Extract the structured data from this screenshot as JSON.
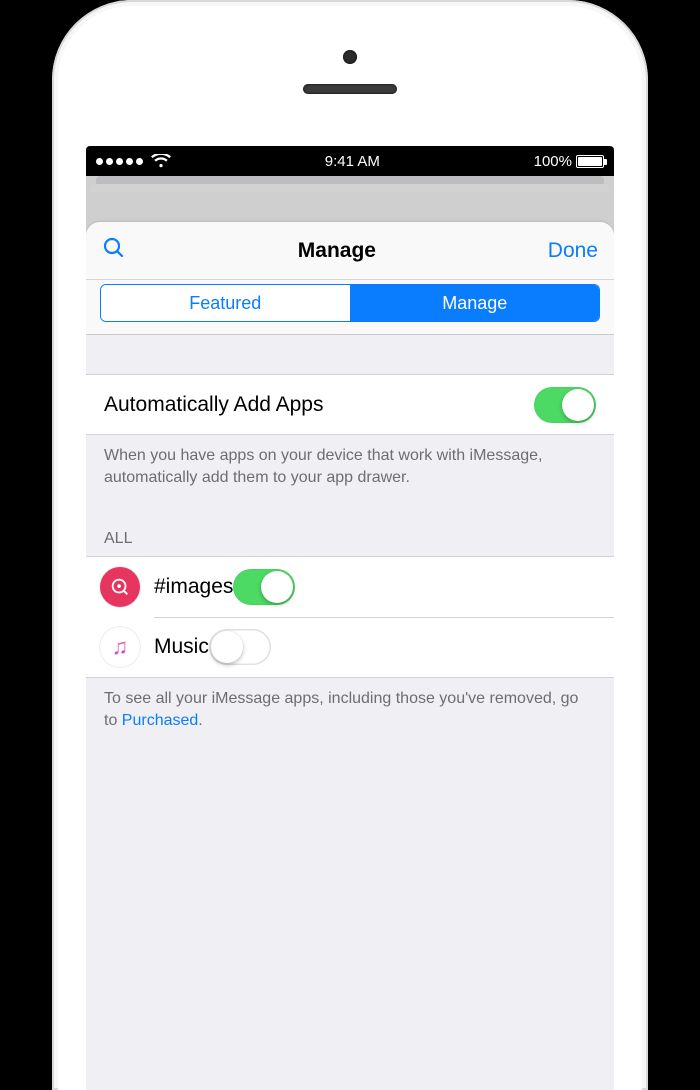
{
  "status": {
    "time": "9:41 AM",
    "battery_pct": "100%"
  },
  "nav": {
    "title": "Manage",
    "done": "Done"
  },
  "segmented": {
    "featured": "Featured",
    "manage": "Manage"
  },
  "auto_add": {
    "label": "Automatically Add Apps",
    "enabled": true,
    "caption": "When you have apps on your device that work with iMessage, automatically add them to your app drawer."
  },
  "sections": {
    "all_header": "ALL"
  },
  "apps": [
    {
      "name": "#images",
      "icon": "images",
      "enabled": true
    },
    {
      "name": "Music",
      "icon": "music",
      "enabled": false
    }
  ],
  "footer": {
    "prefix": "To see all your iMessage apps, including those you've removed, go to ",
    "link": "Purchased",
    "suffix": "."
  }
}
